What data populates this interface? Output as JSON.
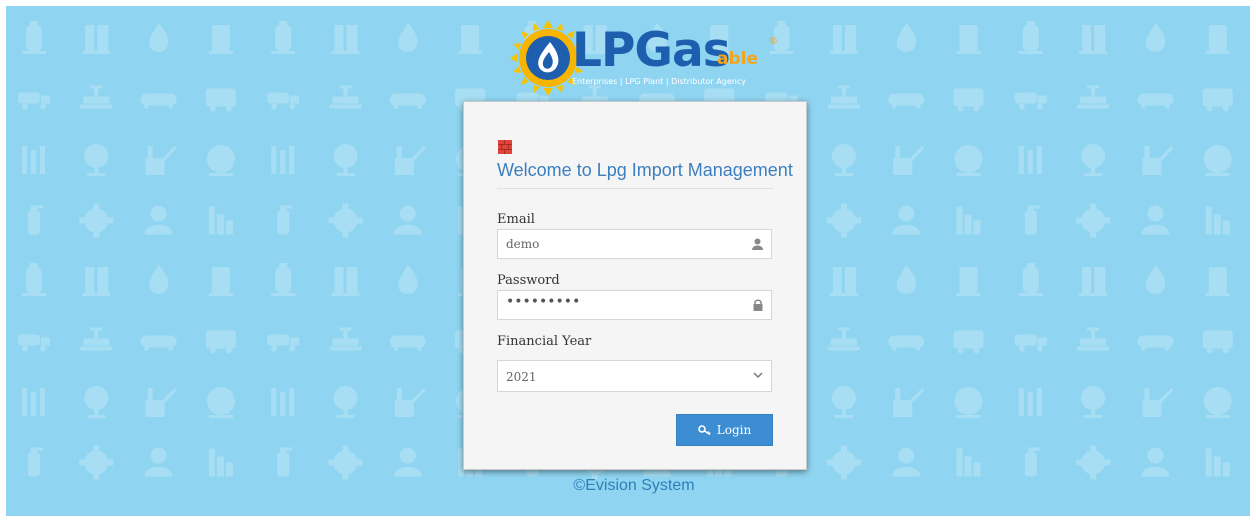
{
  "brand": {
    "name": "LPGas",
    "suffix": "able",
    "registered": "®",
    "tagline": "Enterprises | LPG Plant | Distributor Agency"
  },
  "form": {
    "welcome": "Welcome to Lpg Import Management",
    "email": {
      "label": "Email",
      "value": "demo",
      "icon": "user-icon"
    },
    "password": {
      "label": "Password",
      "value": "•••••••••",
      "icon": "lock-icon"
    },
    "financial_year": {
      "label": "Financial Year",
      "value": "2021",
      "icon": "chevron-down-icon"
    },
    "login": {
      "label": "Login",
      "icon": "key-icon"
    }
  },
  "footer": {
    "text": "©Evision System"
  },
  "colors": {
    "background": "#8fd5f1",
    "title": "#3b7fbf",
    "button": "#3c8dd1",
    "brand_blue": "#1d5fae",
    "brand_orange": "#f2a51e"
  }
}
